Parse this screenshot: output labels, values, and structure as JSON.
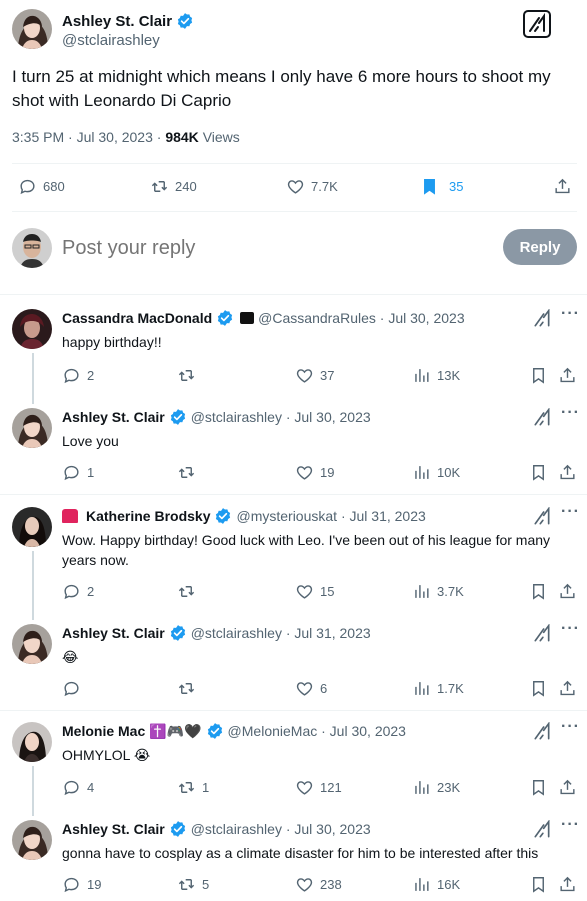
{
  "main_tweet": {
    "author_name": "Ashley St. Clair",
    "author_handle": "@stclairashley",
    "text": "I turn 25 at midnight which means I only have 6 more hours to shoot my shot with Leonardo Di Caprio",
    "time": "3:35 PM · Jul 30, 2023",
    "views_count": "984K",
    "views_label": "Views",
    "replies": "680",
    "retweets": "240",
    "likes": "7.7K",
    "bookmarks": "35"
  },
  "reply_box": {
    "placeholder": "Post your reply",
    "button": "Reply"
  },
  "replies": [
    {
      "name": "Cassandra MacDonald",
      "handle": "@CassandraRules · Jul 30, 2023",
      "text": "happy birthday!!",
      "replies": "2",
      "retweets": "",
      "likes": "37",
      "views": "13K"
    },
    {
      "name": "Ashley St. Clair",
      "handle": "@stclairashley · Jul 30, 2023",
      "text": "Love you",
      "replies": "1",
      "retweets": "",
      "likes": "19",
      "views": "10K"
    },
    {
      "name": "Katherine Brodsky",
      "handle": "@mysteriouskat · Jul 31, 2023",
      "text": "Wow. Happy birthday! Good luck with Leo. I've been out of his league for many years now.",
      "replies": "2",
      "retweets": "",
      "likes": "15",
      "views": "3.7K"
    },
    {
      "name": "Ashley St. Clair",
      "handle": "@stclairashley · Jul 31, 2023",
      "text": "😂",
      "replies": "",
      "retweets": "",
      "likes": "6",
      "views": "1.7K"
    },
    {
      "name": "Melonie Mac",
      "name_emoji": "✝️🎮🖤",
      "handle": "@MelonieMac · Jul 30, 2023",
      "text": "OHMYLOL 😭",
      "replies": "4",
      "retweets": "1",
      "likes": "121",
      "views": "23K"
    },
    {
      "name": "Ashley St. Clair",
      "handle": "@stclairashley · Jul 30, 2023",
      "text": "gonna have to cosplay as a climate disaster for him to be interested after this",
      "replies": "19",
      "retweets": "5",
      "likes": "238",
      "views": "16K"
    }
  ],
  "colors": {
    "accent": "#1d9bf0",
    "muted": "#536471",
    "reply_button": "#8b98a5"
  }
}
